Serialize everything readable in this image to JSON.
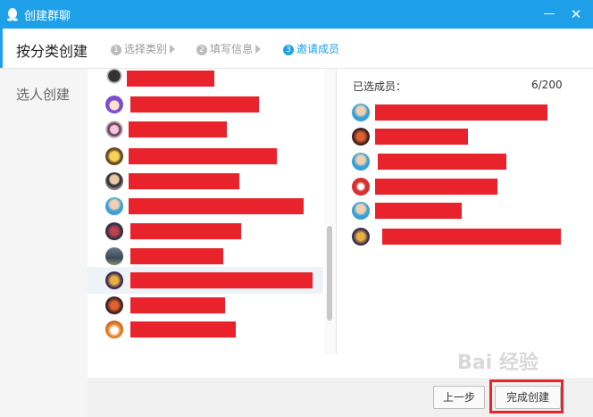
{
  "window": {
    "title": "创建群聊",
    "minimize_glyph": "—",
    "close_glyph": "✕"
  },
  "tabs": {
    "active_title": "按分类创建",
    "steps": [
      {
        "num": "1",
        "label": "选择类别",
        "state": "done"
      },
      {
        "num": "2",
        "label": "填写信息",
        "state": "done"
      },
      {
        "num": "3",
        "label": "邀请成员",
        "state": "active"
      }
    ]
  },
  "sidebar": {
    "items": [
      {
        "label": "选人创建"
      }
    ]
  },
  "selected_panel": {
    "label": "已选成员：",
    "count": "6/200"
  },
  "footer": {
    "prev_label": "上一步",
    "finish_label": "完成创建"
  },
  "watermark": {
    "text": "Bai 经验"
  },
  "colors": {
    "accent": "#1ea0e8",
    "redaction": "#e8232c"
  },
  "contact_avatar_icons": [
    "avatar-dark-icon",
    "avatar-cartoon-purple-icon",
    "avatar-cartoon-pink-icon",
    "avatar-cartoon-face-icon",
    "avatar-person-icon",
    "avatar-person-blue-icon",
    "avatar-person-dark-icon",
    "avatar-landscape-icon",
    "avatar-game-icon",
    "avatar-game-red-icon",
    "avatar-cartoon-fox-icon"
  ],
  "member_avatar_icons": [
    "avatar-person-blue-icon",
    "avatar-game-red-icon",
    "avatar-person-blue-icon",
    "avatar-badge-red-icon",
    "avatar-person-blue-icon",
    "avatar-game-icon"
  ]
}
